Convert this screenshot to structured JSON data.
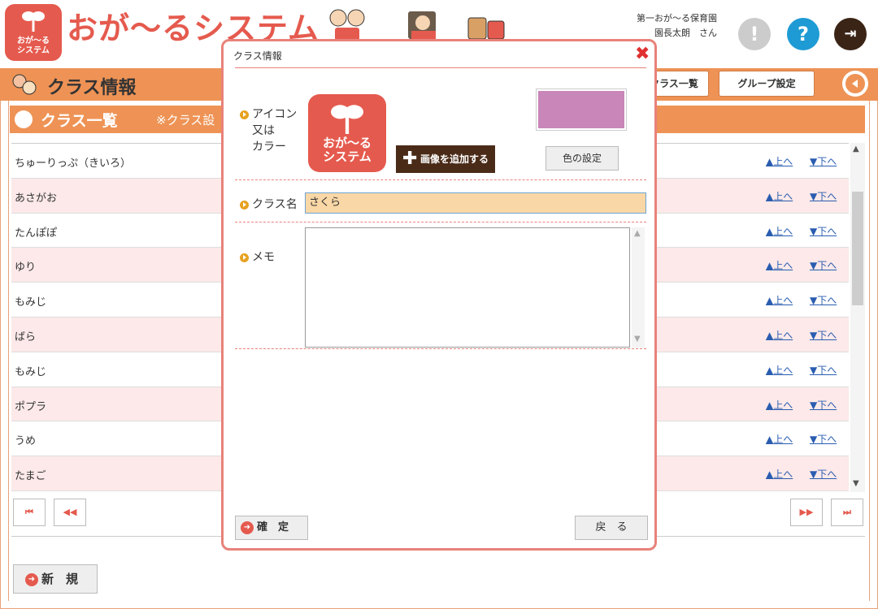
{
  "header": {
    "logo_text_1": "おが〜る",
    "logo_text_2": "システム",
    "app_title": "おが〜るシステム",
    "org_name": "第一おが〜る保育園",
    "user_name": "園長太朗　さん"
  },
  "page": {
    "title": "クラス情報",
    "class_list_button": "クラス一覧",
    "group_setting_button": "グループ設定"
  },
  "list": {
    "title": "クラス一覧",
    "note": "※クラス設",
    "up_label": "▲上へ",
    "down_label": "▼下へ",
    "rows": [
      {
        "name": "ちゅーりっぷ（きいろ）"
      },
      {
        "name": "あさがお"
      },
      {
        "name": "たんぽぽ"
      },
      {
        "name": "ゆり"
      },
      {
        "name": "もみじ"
      },
      {
        "name": "ばら"
      },
      {
        "name": "もみじ"
      },
      {
        "name": "ポプラ"
      },
      {
        "name": "うめ"
      },
      {
        "name": "たまご"
      }
    ],
    "new_button": "新　規"
  },
  "modal": {
    "title": "クラス情報",
    "icon_label_1": "アイコン",
    "icon_label_2": "又は",
    "icon_label_3": "カラー",
    "add_image_button": "画像を追加する",
    "color_button": "色の設定",
    "selected_color": "#c886b9",
    "class_name_label": "クラス名",
    "class_name_value": "さくら",
    "memo_label": "メモ",
    "memo_value": "",
    "confirm_button": "確　定",
    "back_button": "戻　る"
  },
  "colors": {
    "accent": "#ee9355",
    "brand": "#e55a4e"
  }
}
